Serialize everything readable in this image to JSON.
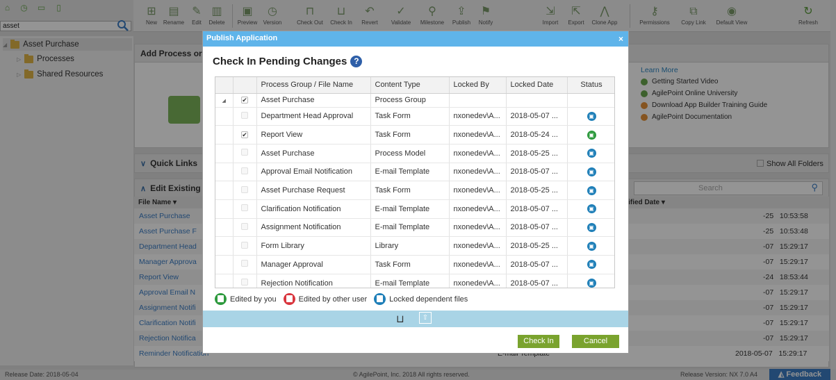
{
  "search": {
    "value": "asset"
  },
  "tree": {
    "root": "Asset Purchase",
    "items": [
      "Processes",
      "Shared Resources"
    ]
  },
  "toolbar": {
    "buttons": [
      "New",
      "Rename",
      "Edit",
      "Delete",
      "Preview",
      "Version",
      "Check Out",
      "Check In",
      "Revert",
      "Validate",
      "Milestone",
      "Publish",
      "Notify",
      "Import",
      "Export",
      "Clone App",
      "Permissions",
      "Copy Link",
      "Default View",
      "Refresh"
    ]
  },
  "main": {
    "add_panel_title": "Add Process or F",
    "learn_more": {
      "title": "Learn More",
      "links": [
        "Getting Started Video",
        "AgilePoint Online University",
        "Download App Builder Training Guide",
        "AgilePoint Documentation"
      ]
    },
    "quick_links": "Quick Links",
    "show_all_folders": "Show All Folders",
    "edit_existing": "Edit Existing",
    "search_placeholder": "Search",
    "file_name_header": "File Name ▾",
    "modified_header": "dified Date ▾",
    "files": [
      {
        "name": "Asset Purchase",
        "date": "-25   10:53:58"
      },
      {
        "name": "Asset Purchase F",
        "date": "-25   10:53:48"
      },
      {
        "name": "Department Head",
        "date": "-07   15:29:17"
      },
      {
        "name": "Manager Approva",
        "date": "-07   15:29:17"
      },
      {
        "name": "Report View",
        "date": "-24   18:53:44"
      },
      {
        "name": "Approval Email N",
        "date": "-07   15:29:17"
      },
      {
        "name": "Assignment Notifi",
        "date": "-07   15:29:17"
      },
      {
        "name": "Clarification Notifi",
        "date": "-07   15:29:17"
      },
      {
        "name": "Rejection Notifica",
        "date": "-07   15:29:17"
      },
      {
        "name": "Reminder Notification",
        "date": "2018-05-07   15:29:17",
        "type": "E-mail Template"
      }
    ]
  },
  "footer": {
    "left": "Release Date: 2018-05-04",
    "center": "© AgilePoint, Inc. 2018 All rights reserved.",
    "right": "Release Version: NX 7.0 A4",
    "feedback": "Feedback"
  },
  "modal": {
    "title": "Publish Application",
    "close": "×",
    "heading": "Check In Pending Changes",
    "help": "?",
    "columns": [
      "Process Group / File Name",
      "Content Type",
      "Locked By",
      "Locked Date",
      "Status"
    ],
    "rows": [
      {
        "name": "Asset Purchase",
        "type": "Process Group",
        "by": "",
        "date": "",
        "status": "",
        "checked": true,
        "group": true
      },
      {
        "name": "Department Head Approval",
        "type": "Task Form",
        "by": "nxonedev\\A...",
        "date": "2018-05-07 ...",
        "status": "blue",
        "checked": false
      },
      {
        "name": "Report View",
        "type": "Task Form",
        "by": "nxonedev\\A...",
        "date": "2018-05-24 ...",
        "status": "green",
        "checked": true
      },
      {
        "name": "Asset Purchase",
        "type": "Process Model",
        "by": "nxonedev\\A...",
        "date": "2018-05-25 ...",
        "status": "blue",
        "checked": false
      },
      {
        "name": "Approval Email Notification",
        "type": "E-mail Template",
        "by": "nxonedev\\A...",
        "date": "2018-05-07 ...",
        "status": "blue",
        "checked": false
      },
      {
        "name": "Asset Purchase Request",
        "type": "Task Form",
        "by": "nxonedev\\A...",
        "date": "2018-05-25 ...",
        "status": "blue",
        "checked": false
      },
      {
        "name": "Clarification Notification",
        "type": "E-mail Template",
        "by": "nxonedev\\A...",
        "date": "2018-05-07 ...",
        "status": "blue",
        "checked": false
      },
      {
        "name": "Assignment Notification",
        "type": "E-mail Template",
        "by": "nxonedev\\A...",
        "date": "2018-05-07 ...",
        "status": "blue",
        "checked": false
      },
      {
        "name": "Form Library",
        "type": "Library",
        "by": "nxonedev\\A...",
        "date": "2018-05-25 ...",
        "status": "blue",
        "checked": false
      },
      {
        "name": "Manager Approval",
        "type": "Task Form",
        "by": "nxonedev\\A...",
        "date": "2018-05-07 ...",
        "status": "blue",
        "checked": false
      },
      {
        "name": "Rejection Notification",
        "type": "E-mail Template",
        "by": "nxonedev\\A...",
        "date": "2018-05-07 ...",
        "status": "blue",
        "checked": false
      }
    ],
    "legend": [
      "Edited by you",
      "Edited by other user",
      "Locked dependent files"
    ],
    "check_in": "Check In",
    "cancel": "Cancel",
    "colors": {
      "green": "#2e9a3e",
      "red": "#d9363e",
      "blue": "#1f7fb8",
      "accent": "#5fb4ea",
      "button": "#7aa32e"
    }
  }
}
